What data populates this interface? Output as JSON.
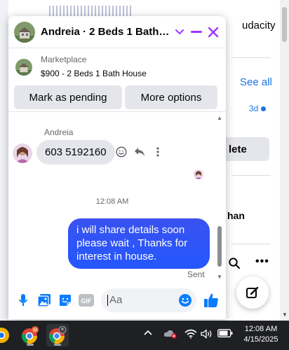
{
  "background_page": {
    "audacity_text": "udacity",
    "see_all": "See all",
    "time_ago": "3d",
    "delete_button": "lete",
    "partial_name": "han"
  },
  "chat": {
    "title": "Andreia · 2 Beds 1 Bath Ho...",
    "marketplace": {
      "label": "Marketplace",
      "item": "$900 - 2 Beds 1 Bath House",
      "mark_pending": "Mark as pending",
      "more_options": "More options"
    },
    "messages": {
      "sender_name": "Andreia",
      "incoming_text": "603 5192160",
      "timestamp": "12:08 AM",
      "outgoing_text": "i will share details soon please wait , Thanks for interest in house.",
      "status": "Sent"
    },
    "composer": {
      "placeholder": "Aa",
      "gif_label": "GIF"
    }
  },
  "taskbar": {
    "time": "12:08 AM",
    "date": "4/15/2025",
    "badge": "M"
  },
  "colors": {
    "accent_purple": "#a033ff",
    "messenger_blue": "#0a7cff",
    "bubble_outgoing": "#2457ff",
    "gray_button": "#e4e6eb"
  }
}
